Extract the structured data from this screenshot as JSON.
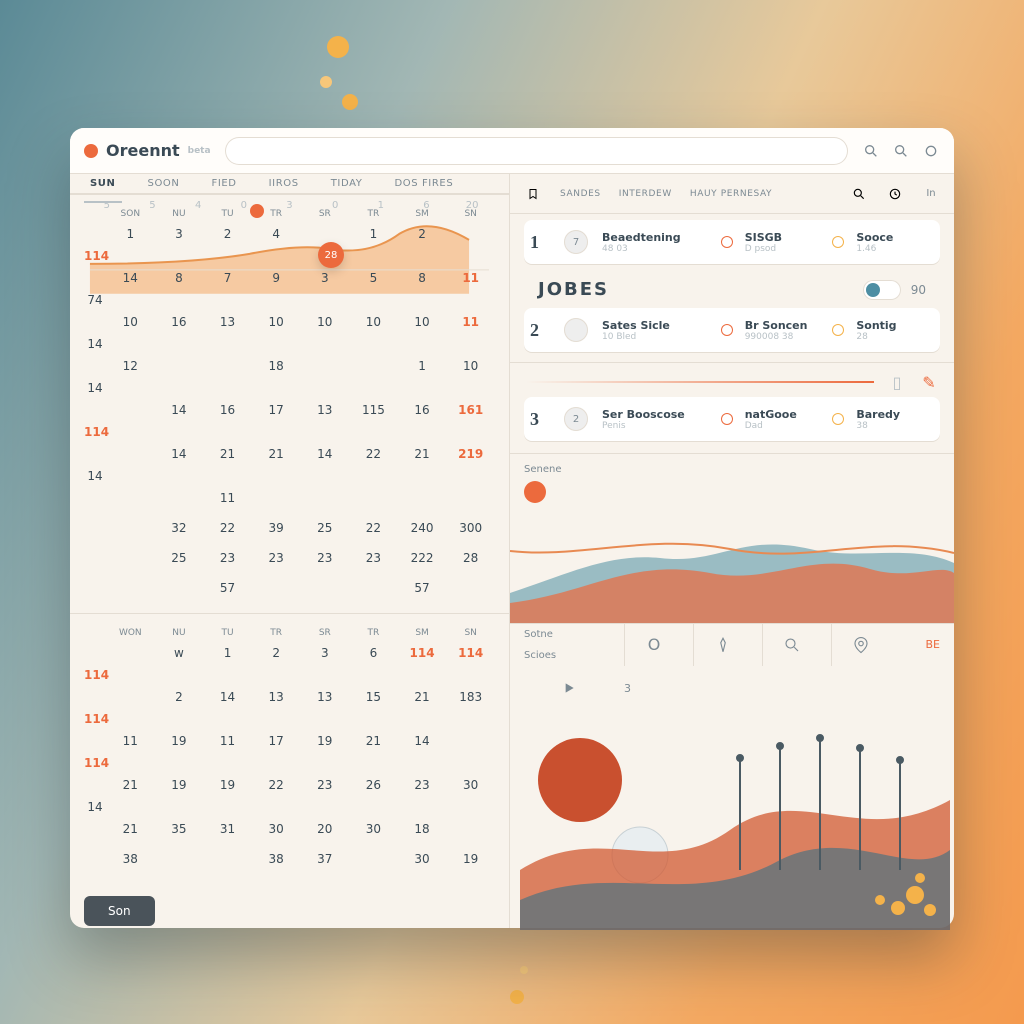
{
  "brand": {
    "name": "Oreennt",
    "tag": "beta"
  },
  "header_icons": [
    "search",
    "search",
    "circle"
  ],
  "left_tabs": [
    "SUN",
    "SOON",
    "FIED",
    "IIROS",
    "TIDAY",
    "DOS FIRES"
  ],
  "spark": {
    "bubble": "28",
    "values": [
      "5",
      "5",
      "4",
      "0",
      "3",
      "0",
      "1",
      "6",
      "20"
    ]
  },
  "cal1": {
    "head": [
      "",
      "SON",
      "Nu",
      "Tu",
      "Tr",
      "Sr",
      "Tr",
      "Sm",
      "Sn"
    ],
    "rows": [
      [
        "",
        "1",
        "3",
        "2",
        "4",
        "●",
        "1",
        "2",
        "●",
        "114"
      ],
      [
        "",
        "14",
        "8",
        "7",
        "9",
        "3",
        "5",
        "8",
        "11",
        "74"
      ],
      [
        "",
        "10",
        "16",
        "13",
        "10",
        "10",
        "10",
        "10",
        "11",
        "14"
      ],
      [
        "",
        "12",
        "",
        "",
        "18",
        "",
        "",
        "1",
        "10",
        "14"
      ],
      [
        "",
        "",
        "14",
        "16",
        "17",
        "13",
        "115",
        "16",
        "161",
        "114"
      ],
      [
        "",
        "",
        "14",
        "21",
        "21",
        "14",
        "22",
        "21",
        "219",
        "14"
      ],
      [
        "",
        "",
        "",
        "11",
        "",
        "",
        "",
        "",
        "",
        ""
      ],
      [
        "",
        "",
        "32",
        "22",
        "39",
        "25",
        "22",
        "240",
        "300",
        ""
      ],
      [
        "",
        "",
        "25",
        "23",
        "23",
        "23",
        "23",
        "222",
        "28",
        ""
      ],
      [
        "",
        "",
        "",
        "57",
        "",
        "",
        "",
        "57",
        "",
        ""
      ]
    ]
  },
  "cal2": {
    "head": [
      "",
      "WON",
      "Nu",
      "Tu",
      "Tr",
      "Sr",
      "Tr",
      "Sm",
      "Sn"
    ],
    "rows": [
      [
        "",
        "",
        "w",
        "1",
        "2",
        "3",
        "6",
        "114",
        "114",
        "114"
      ],
      [
        "",
        "",
        "2",
        "14",
        "13",
        "13",
        "15",
        "21",
        "183",
        "114"
      ],
      [
        "",
        "11",
        "19",
        "11",
        "17",
        "19",
        "21",
        "14",
        "●",
        "114"
      ],
      [
        "",
        "21",
        "19",
        "19",
        "22",
        "23",
        "26",
        "23",
        "30",
        "14"
      ],
      [
        "",
        "21",
        "35",
        "31",
        "30",
        "20",
        "30",
        "18",
        "",
        ""
      ],
      [
        "",
        "38",
        "",
        "",
        "38",
        "37",
        "",
        "30",
        "19",
        ""
      ]
    ]
  },
  "save": "Son",
  "right_tabs": [
    "SANDES",
    "INTERDEW",
    "HAUY PERNESAY"
  ],
  "jobes_title": "JOBES",
  "jobs": [
    {
      "n": "1",
      "av": "7",
      "a": "Beaedtening",
      "a2": "48 03",
      "b": "SISGB",
      "b2": "D psod",
      "c": "Sooce",
      "c2": "1.46"
    },
    {
      "n": "2",
      "av": "",
      "a": "Sates Sicle",
      "a2": "10 Bled",
      "b": "Br Soncen",
      "b2": "990008 38",
      "c": "Sontig",
      "c2": "28"
    },
    {
      "n": "3",
      "av": "2",
      "a": "Ser Booscose",
      "a2": "Penis",
      "b": "natGooe",
      "b2": "Dad",
      "c": "Baredy",
      "c2": "38"
    }
  ],
  "jobes_count": "90",
  "wave_label": "Senene",
  "footer": {
    "l1": "Sotne",
    "l2": "Scioes",
    "v1": "O",
    "v2": "3",
    "end": "BE"
  }
}
